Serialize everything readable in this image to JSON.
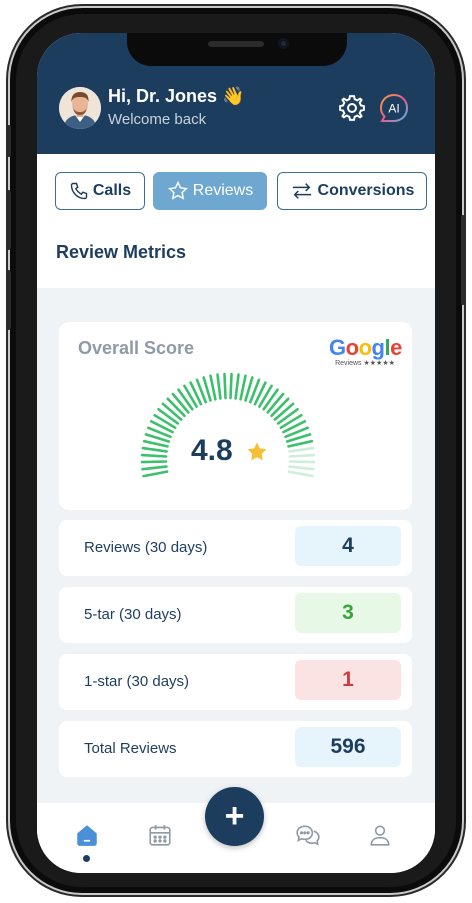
{
  "header": {
    "greeting": "Hi, Dr. Jones 👋",
    "subtitle": "Welcome back",
    "ai_label": "AI"
  },
  "tabs": [
    {
      "label": "Calls",
      "active": false
    },
    {
      "label": "Reviews",
      "active": true
    },
    {
      "label": "Conversions",
      "active": false
    }
  ],
  "section_title": "Review Metrics",
  "overall": {
    "label": "Overall Score",
    "score": "4.8",
    "score_fraction": 0.96,
    "provider_logo": "Google",
    "provider_sub": "Reviews ★★★★★"
  },
  "metrics": [
    {
      "label": "Reviews (30 days)",
      "value": "4",
      "bg": "#e6f5fc",
      "color": "#1d3d5f"
    },
    {
      "label": "5-tar (30 days)",
      "value": "3",
      "bg": "#e7f8e6",
      "color": "#3aa43a"
    },
    {
      "label": "1-star (30 days)",
      "value": "1",
      "bg": "#fbe3e3",
      "color": "#d33a3a"
    },
    {
      "label": "Total Reviews",
      "value": "596",
      "bg": "#e6f5fc",
      "color": "#1d3d5f"
    }
  ],
  "nav": {
    "fab_label": "+",
    "items": [
      "home-icon",
      "calendar-icon",
      "chat-icon",
      "profile-icon"
    ]
  },
  "colors": {
    "primary": "#1d3d5f",
    "accent": "#6ea7cf",
    "gauge": "#3cc06b",
    "star": "#f5c033"
  }
}
